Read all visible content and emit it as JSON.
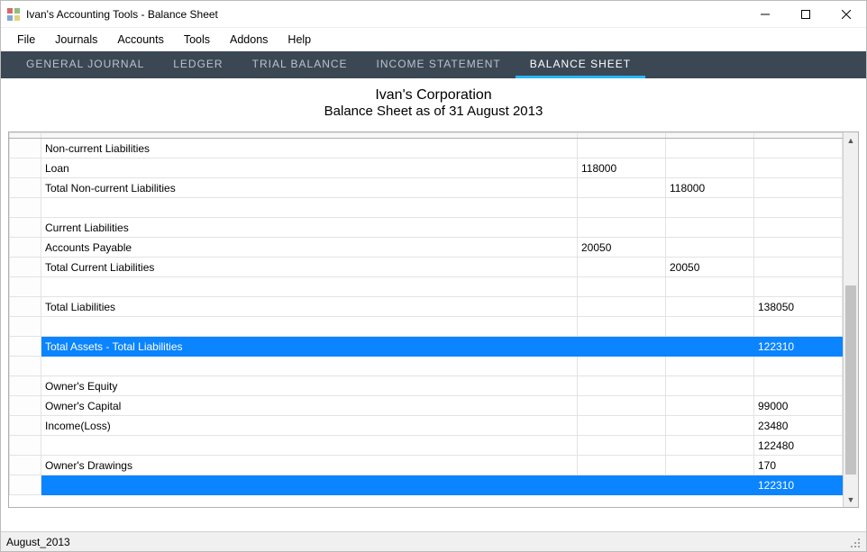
{
  "window": {
    "title": "Ivan's Accounting Tools - Balance Sheet"
  },
  "menu": {
    "items": [
      "File",
      "Journals",
      "Accounts",
      "Tools",
      "Addons",
      "Help"
    ]
  },
  "tabs": {
    "items": [
      {
        "label": "GENERAL JOURNAL",
        "active": false
      },
      {
        "label": "LEDGER",
        "active": false
      },
      {
        "label": "TRIAL BALANCE",
        "active": false
      },
      {
        "label": "INCOME STATEMENT",
        "active": false
      },
      {
        "label": "BALANCE SHEET",
        "active": true
      }
    ]
  },
  "report": {
    "company": "Ivan's Corporation",
    "subtitle": "Balance Sheet as of 31 August 2013"
  },
  "rows": [
    {
      "label": "Non-current Liabilities",
      "c1": "",
      "c2": "",
      "c3": "",
      "selected": false
    },
    {
      "label": "Loan",
      "c1": "118000",
      "c2": "",
      "c3": "",
      "selected": false
    },
    {
      "label": "Total Non-current Liabilities",
      "c1": "",
      "c2": "118000",
      "c3": "",
      "selected": false
    },
    {
      "label": "",
      "c1": "",
      "c2": "",
      "c3": "",
      "selected": false
    },
    {
      "label": "Current Liabilities",
      "c1": "",
      "c2": "",
      "c3": "",
      "selected": false
    },
    {
      "label": "Accounts Payable",
      "c1": "20050",
      "c2": "",
      "c3": "",
      "selected": false
    },
    {
      "label": "Total Current Liabilities",
      "c1": "",
      "c2": "20050",
      "c3": "",
      "selected": false
    },
    {
      "label": "",
      "c1": "",
      "c2": "",
      "c3": "",
      "selected": false
    },
    {
      "label": "Total Liabilities",
      "c1": "",
      "c2": "",
      "c3": "138050",
      "selected": false
    },
    {
      "label": "",
      "c1": "",
      "c2": "",
      "c3": "",
      "selected": false
    },
    {
      "label": "Total Assets - Total Liabilities",
      "c1": "",
      "c2": "",
      "c3": "122310",
      "selected": true
    },
    {
      "label": "",
      "c1": "",
      "c2": "",
      "c3": "",
      "selected": false
    },
    {
      "label": "Owner's Equity",
      "c1": "",
      "c2": "",
      "c3": "",
      "selected": false
    },
    {
      "label": "Owner's Capital",
      "c1": "",
      "c2": "",
      "c3": "99000",
      "selected": false
    },
    {
      "label": "Income(Loss)",
      "c1": "",
      "c2": "",
      "c3": "23480",
      "selected": false
    },
    {
      "label": "",
      "c1": "",
      "c2": "",
      "c3": "122480",
      "selected": false
    },
    {
      "label": "Owner's Drawings",
      "c1": "",
      "c2": "",
      "c3": "170",
      "selected": false
    },
    {
      "label": "",
      "c1": "",
      "c2": "",
      "c3": "122310",
      "selected": true
    }
  ],
  "status": {
    "text": "August_2013"
  }
}
